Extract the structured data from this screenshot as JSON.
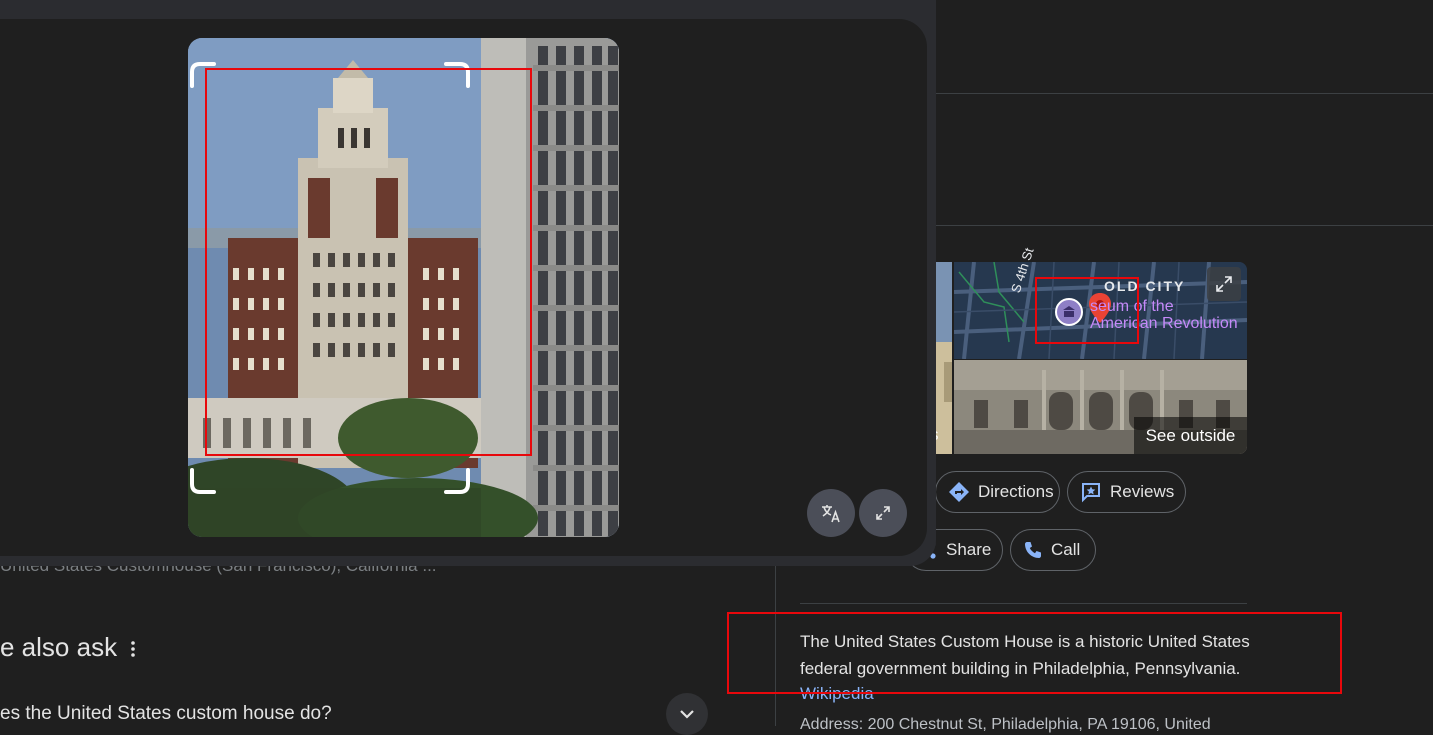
{
  "lens": {
    "translate_icon": "translate-icon",
    "fullscreen_icon": "fullscreen-exit-icon"
  },
  "results": {
    "truncated_result": "United States Customhouse (San Francisco), California ...",
    "paa_heading": "e also ask",
    "paa_question": "es the United States custom house do?"
  },
  "knowledge_panel": {
    "map": {
      "area_label": "OLD CITY",
      "poi_label_line1": "seum of the",
      "poi_label_line2": "American Revolution",
      "street_label": "S 4th St"
    },
    "streetview_label": "See outside",
    "sliver_label": "s",
    "actions": [
      {
        "label": "Directions",
        "icon": "directions-icon"
      },
      {
        "label": "Reviews",
        "icon": "reviews-icon"
      },
      {
        "label": "Share",
        "icon": "share-icon"
      },
      {
        "label": "Call",
        "icon": "phone-icon"
      }
    ],
    "description": "The United States Custom House is a historic United States federal government building in Philadelphia, Pennsylvania.",
    "source_link": "Wikipedia",
    "address_partial": "Address: 200 Chestnut St, Philadelphia, PA 19106, United"
  },
  "colors": {
    "background": "#1f1f1f",
    "overlay_frame": "#2b2c30",
    "link": "#8ab4f8",
    "highlight_box": "#e8080c",
    "map_pin": "#ea4335"
  }
}
